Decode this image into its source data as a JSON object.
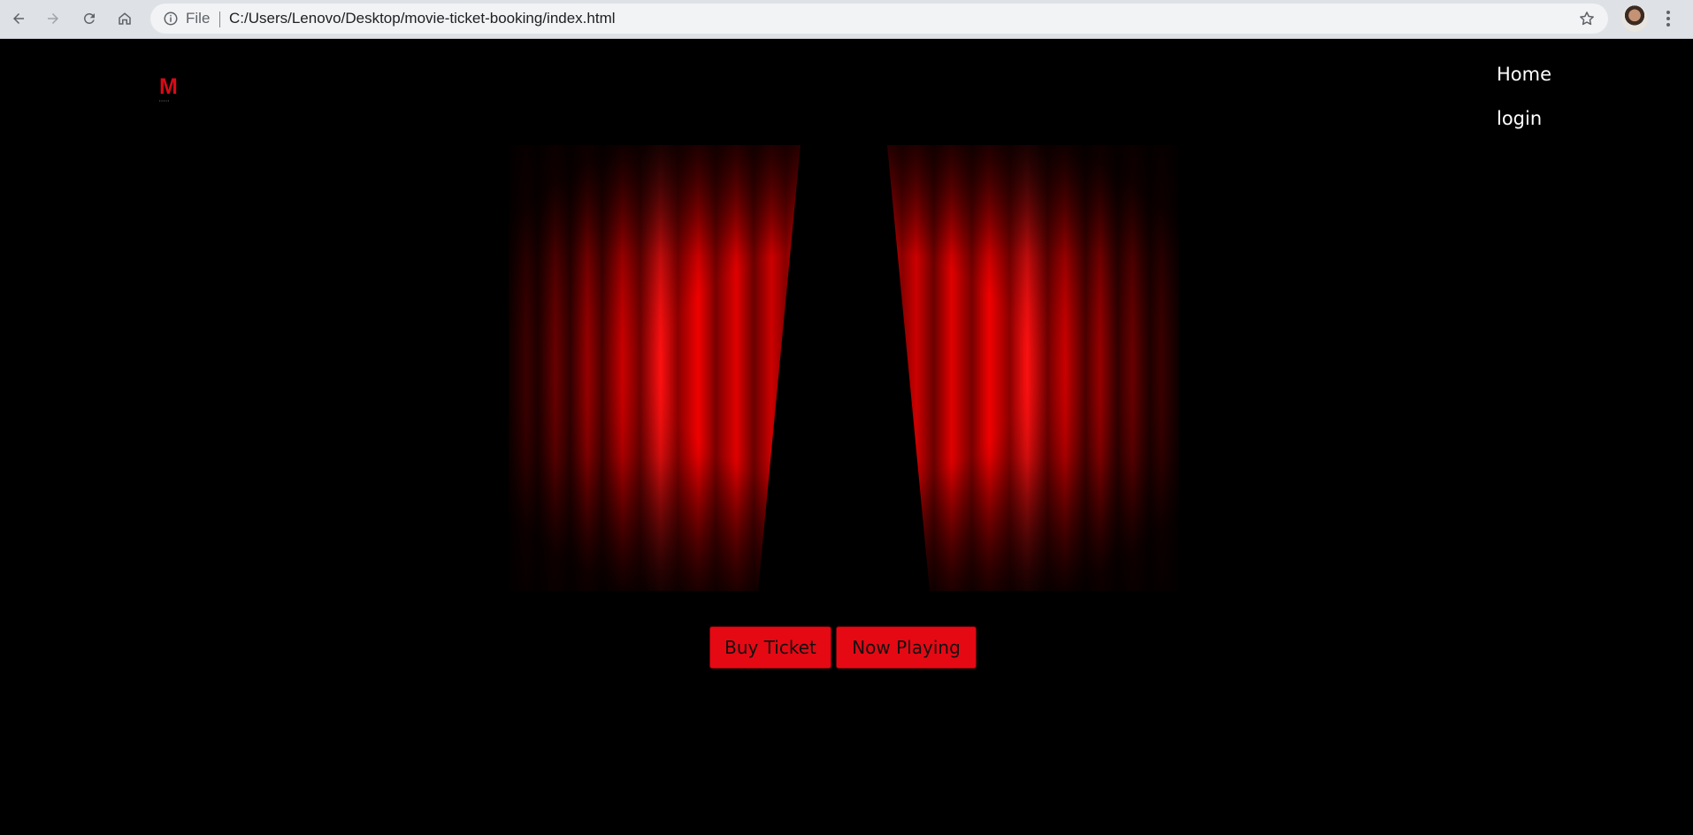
{
  "browser": {
    "scheme_label": "File",
    "url": "C:/Users/Lenovo/Desktop/movie-ticket-booking/index.html",
    "icons": {
      "back": "arrow-left-icon",
      "forward": "arrow-right-icon",
      "reload": "reload-icon",
      "home": "home-icon",
      "info": "info-icon",
      "bookmark": "star-icon",
      "menu": "kebab-menu-icon"
    }
  },
  "site": {
    "logo_letter": "M",
    "logo_color": "#d90a17",
    "nav": {
      "home_label": "Home",
      "login_label": "login"
    },
    "hero_image": "red-theater-curtains",
    "actions": {
      "buy_label": "Buy Ticket",
      "now_playing_label": "Now Playing"
    },
    "accent_color": "#e50914",
    "background_color": "#000000"
  }
}
